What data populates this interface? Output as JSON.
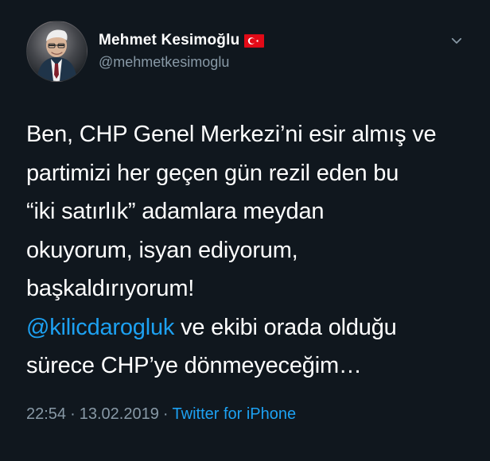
{
  "tweet": {
    "author": {
      "display_name": "Mehmet Kesimoğlu",
      "username": "@mehmetkesimoglu",
      "flag_icon": "turkey-flag-icon",
      "avatar_icon": "profile-photo"
    },
    "menu_icon": "chevron-down-icon",
    "body": {
      "line1": "Ben, CHP Genel Merkezi’ni esir almış ve",
      "line2": "partimizi her geçen gün rezil eden bu",
      "line3": "“iki satırlık” adamlara meydan",
      "line4": "okuyorum, isyan ediyorum,",
      "line5": "başkaldırıyorum!",
      "mention": "@kilicdarogluk",
      "line6_rest": " ve ekibi orada olduğu",
      "line7": "sürece CHP’ye dönmeyeceğim…"
    },
    "meta": {
      "time": "22:54",
      "sep1": "·",
      "date": "13.02.2019",
      "sep2": "·",
      "source": "Twitter for iPhone"
    }
  },
  "colors": {
    "background": "#10171e",
    "text": "#ffffff",
    "muted": "#8899a6",
    "link": "#1da1f2",
    "flag_red": "#e30a17"
  }
}
